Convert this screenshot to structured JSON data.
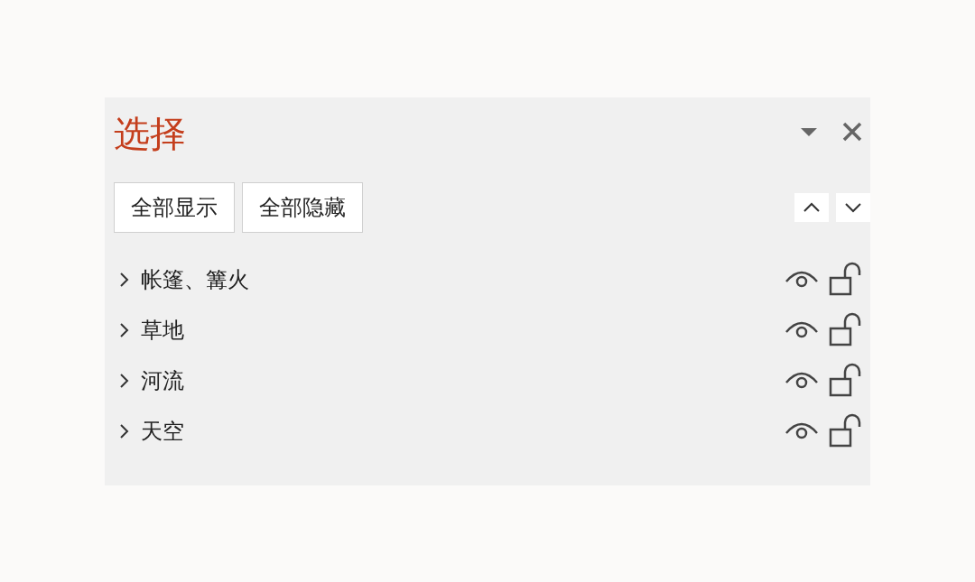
{
  "panel": {
    "title": "选择"
  },
  "buttons": [
    "全部显示",
    "全部隐藏"
  ],
  "items": [
    {
      "label": "帐篷、篝火",
      "expanded": false,
      "visible": true,
      "locked": false
    },
    {
      "label": "草地",
      "expanded": false,
      "visible": true,
      "locked": false
    },
    {
      "label": "河流",
      "expanded": false,
      "visible": true,
      "locked": false
    },
    {
      "label": "天空",
      "expanded": false,
      "visible": true,
      "locked": false
    }
  ]
}
